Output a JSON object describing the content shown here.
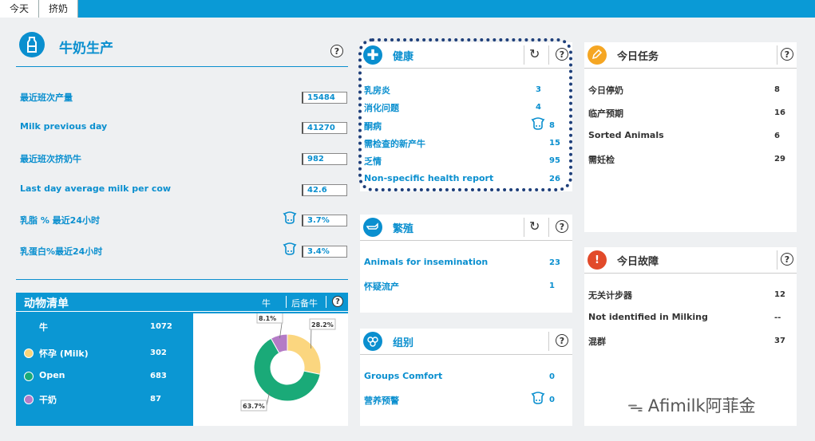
{
  "tabs": [
    "今天",
    "挤奶"
  ],
  "milk": {
    "title": "牛奶生产",
    "rows": [
      {
        "label": "最近班次产量",
        "value": "15484"
      },
      {
        "label": "Milk previous day",
        "value": "41270"
      },
      {
        "label": "最近班次挤奶牛",
        "value": "982"
      },
      {
        "label": "Last day average milk per cow",
        "value": "42.6"
      },
      {
        "label": "乳脂 % 最近24小时",
        "value": "3.7%"
      },
      {
        "label": "乳蛋白%最近24小时",
        "value": "3.4%"
      }
    ]
  },
  "animals": {
    "title": "动物清单",
    "tab1": "牛",
    "tab2": "后备牛",
    "rows": [
      {
        "label": "牛",
        "value": "1072"
      },
      {
        "label": "怀孕 (Milk)",
        "value": "302"
      },
      {
        "label": "Open",
        "value": "683"
      },
      {
        "label": "干奶",
        "value": "87"
      }
    ],
    "colors": {
      "pregnant": "#f9d57a",
      "open": "#1aaa78",
      "dry": "#b47bc6"
    }
  },
  "chart_data": {
    "type": "pie",
    "categories": [
      "怀孕 (Milk)",
      "Open",
      "干奶"
    ],
    "values": [
      28.2,
      63.7,
      8.1
    ],
    "labels": [
      "28.2%",
      "63.7%",
      "8.1%"
    ],
    "colors": [
      "#fbd67f",
      "#1aaa78",
      "#b47bc6"
    ]
  },
  "health": {
    "title": "健康",
    "rows": [
      {
        "label": "乳房炎",
        "value": "3"
      },
      {
        "label": "消化问题",
        "value": "4"
      },
      {
        "label": "酮病",
        "value": "8"
      },
      {
        "label": "需检查的新产牛",
        "value": "15"
      },
      {
        "label": "乏情",
        "value": "95"
      },
      {
        "label": "Non-specific health report",
        "value": "26"
      }
    ]
  },
  "breeding": {
    "title": "繁殖",
    "rows": [
      {
        "label": "Animals for insemination",
        "value": "23"
      },
      {
        "label": "怀疑流产",
        "value": "1"
      }
    ]
  },
  "groups": {
    "title": "组别",
    "rows": [
      {
        "label": "Groups Comfort",
        "value": "0"
      },
      {
        "label": "营养预警",
        "value": "0"
      }
    ]
  },
  "tasks": {
    "title": "今日任务",
    "rows": [
      {
        "label": "今日停奶",
        "value": "8"
      },
      {
        "label": "临产预期",
        "value": "16"
      },
      {
        "label": "Sorted Animals",
        "value": "6"
      },
      {
        "label": "需妊检",
        "value": "29"
      }
    ]
  },
  "faults": {
    "title": "今日故障",
    "rows": [
      {
        "label": "无关计步器",
        "value": "12"
      },
      {
        "label": "Not identified in Milking",
        "value": "--"
      },
      {
        "label": "混群",
        "value": "37"
      }
    ]
  },
  "watermark": "Afimilk阿菲金",
  "icons": {
    "help": "?",
    "refresh": "↻"
  }
}
